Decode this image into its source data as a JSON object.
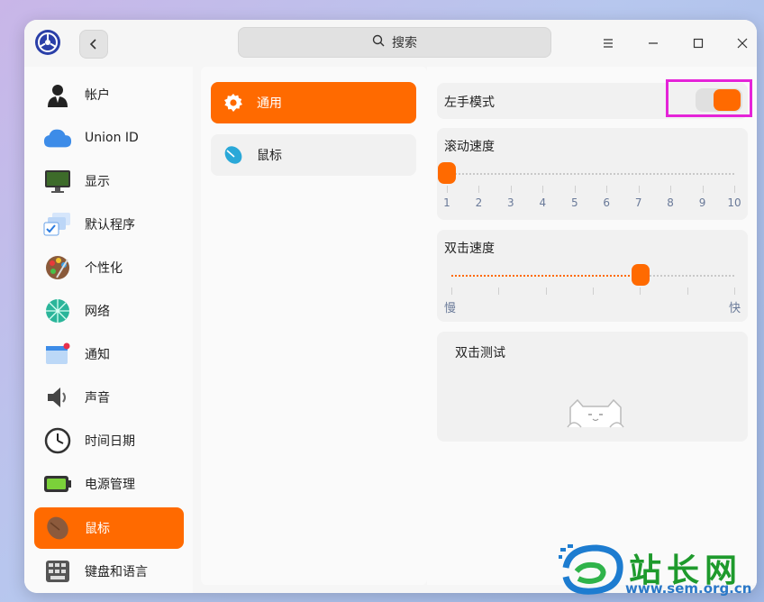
{
  "titlebar": {
    "search_placeholder": "搜索",
    "colors": {
      "accent": "#ff6a00"
    }
  },
  "sidebar": {
    "items": [
      {
        "label": "帐户",
        "icon": "user-avatar-icon"
      },
      {
        "label": "Union ID",
        "icon": "cloud-icon"
      },
      {
        "label": "显示",
        "icon": "monitor-icon"
      },
      {
        "label": "默认程序",
        "icon": "default-apps-icon"
      },
      {
        "label": "个性化",
        "icon": "palette-icon"
      },
      {
        "label": "网络",
        "icon": "network-globe-icon"
      },
      {
        "label": "通知",
        "icon": "notification-icon"
      },
      {
        "label": "声音",
        "icon": "speaker-icon"
      },
      {
        "label": "时间日期",
        "icon": "clock-icon"
      },
      {
        "label": "电源管理",
        "icon": "battery-icon"
      },
      {
        "label": "鼠标",
        "icon": "mouse-icon",
        "active": true
      },
      {
        "label": "键盘和语言",
        "icon": "keyboard-icon"
      }
    ]
  },
  "subnav": {
    "items": [
      {
        "label": "通用",
        "icon": "gear-icon",
        "active": true
      },
      {
        "label": "鼠标",
        "icon": "mouse-icon"
      }
    ]
  },
  "settings": {
    "left_hand_mode": {
      "label": "左手模式",
      "enabled": true
    },
    "scroll_speed": {
      "label": "滚动速度",
      "value": 1,
      "ticks": [
        "1",
        "2",
        "3",
        "4",
        "5",
        "6",
        "7",
        "8",
        "9",
        "10"
      ]
    },
    "double_click_speed": {
      "label": "双击速度",
      "value_fraction": 0.67,
      "min_label": "慢",
      "max_label": "快"
    },
    "double_click_test": {
      "label": "双击测试",
      "icon": "cat-peek-icon"
    }
  },
  "watermark": {
    "text": "站长网",
    "url": "www.sem.org.cn"
  }
}
